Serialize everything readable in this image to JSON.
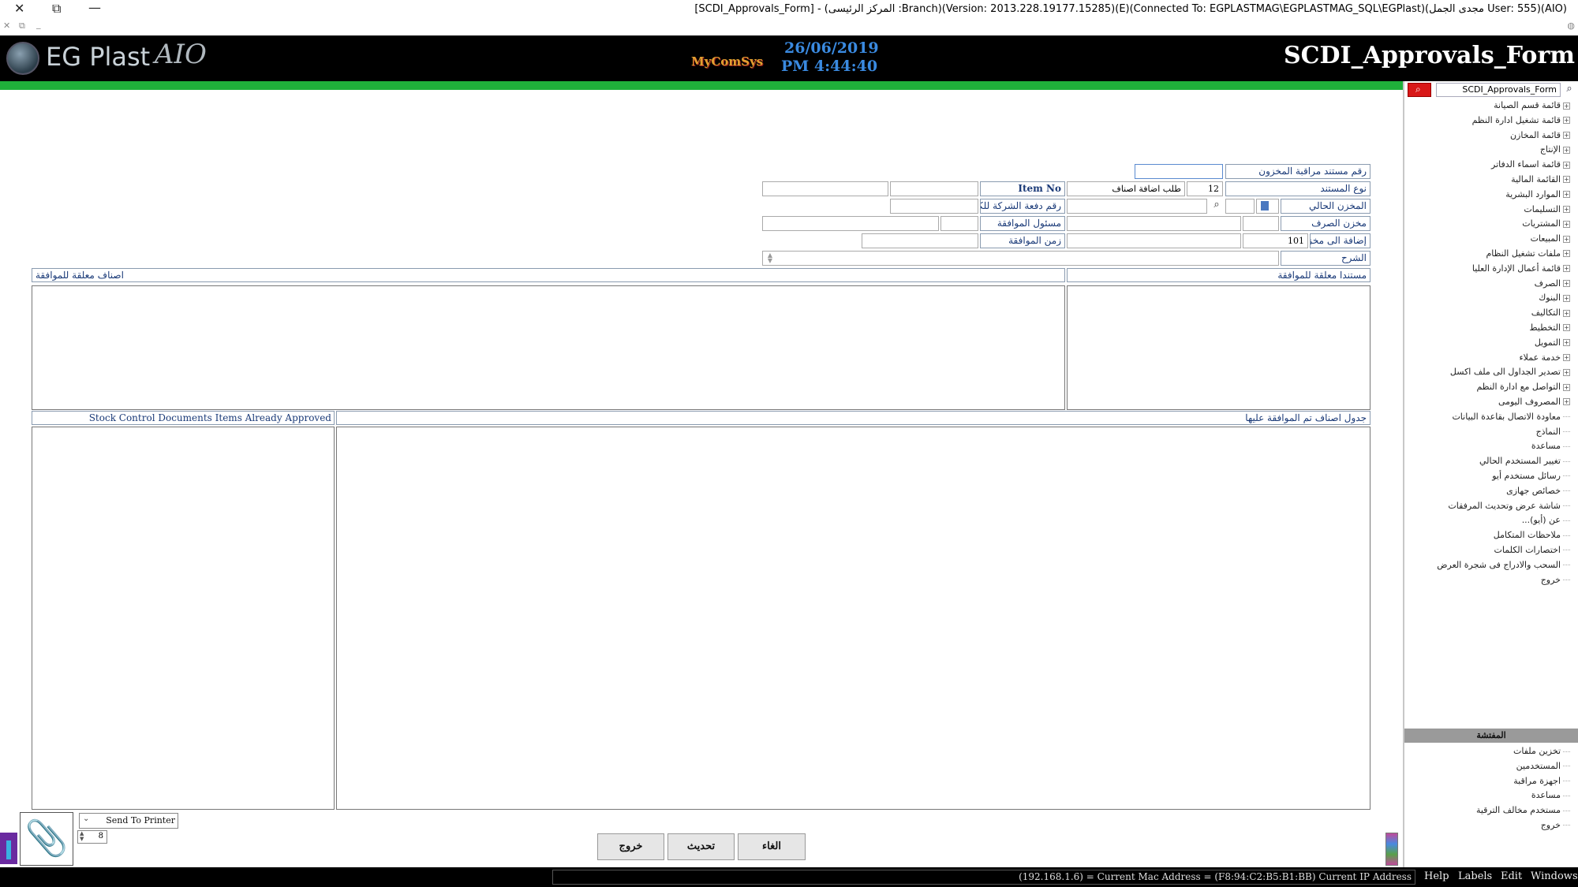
{
  "window": {
    "title": "[SCDI_Approvals_Form] - (المركز الرئيسى :Branch)(Version: 2013.228.19177.15285)(E)(Connected To: EGPLASTMAG\\EGPLASTMAG_SQL\\EGPlast)(مجدى الجمل User: 555)(AIO)",
    "close": "✕",
    "restore": "⧉",
    "minimize": "—"
  },
  "header": {
    "logo": "EG Plast",
    "logo_suffix": "AIO",
    "brand": "MyComSys",
    "date": "26/06/2019",
    "time": "PM 4:44:40",
    "form_title": "SCDI_Approvals_Form"
  },
  "form": {
    "doc_number_label": "رقم مستند مراقبة المخزون",
    "doc_type_label": "نوع المستند",
    "doc_type_code": "12",
    "doc_type_name": "طلب اضافة اصناف",
    "item_no_label": "Item No",
    "current_store_label": "المخزن الحالي",
    "company_batch_label": "رقم دفعة الشركة للكمية",
    "expense_store_label": "مخزن الصرف",
    "approver_label": "مسئول الموافقة",
    "add_to_store_label": "إضافة الى مخزن",
    "add_to_store_code": "101",
    "approval_time_label": "زمن الموافقة",
    "notes_label": "الشرح"
  },
  "panels": {
    "pending_docs": "مستندا معلقة للموافقة",
    "pending_items": "اصناف معلقة للموافقة",
    "approved_items_table": "جدول اصناف تم الموافقة عليها",
    "already_approved": "Stock Control Documents Items Already Approved"
  },
  "buttons": {
    "cancel": "الغاء",
    "refresh": "تحديث",
    "exit": "خروج"
  },
  "printer": {
    "label": "Send To Printer",
    "copies": "8"
  },
  "sidebar": {
    "search_value": "SCDI_Approvals_Form",
    "items": [
      {
        "label": "قائمة قسم الصيانة",
        "expandable": true
      },
      {
        "label": "قائمة تشغيل ادارة النظم",
        "expandable": true
      },
      {
        "label": "قائمة المخازن",
        "expandable": true
      },
      {
        "label": "الإنتاج",
        "expandable": true
      },
      {
        "label": "قائمة اسماء الدفاتر",
        "expandable": true
      },
      {
        "label": "القائمة المالية",
        "expandable": true
      },
      {
        "label": "الموارد البشرية",
        "expandable": true
      },
      {
        "label": "التسليمات",
        "expandable": true
      },
      {
        "label": "المشتريات",
        "expandable": true
      },
      {
        "label": "المبيعات",
        "expandable": true
      },
      {
        "label": "ملفات تشغيل النظام",
        "expandable": true
      },
      {
        "label": "قائمة أعمال الإدارة العليا",
        "expandable": true
      },
      {
        "label": "الصرف",
        "expandable": true
      },
      {
        "label": "البنوك",
        "expandable": true
      },
      {
        "label": "التكاليف",
        "expandable": true
      },
      {
        "label": "التخطيط",
        "expandable": true
      },
      {
        "label": "التمويل",
        "expandable": true
      },
      {
        "label": "خدمة عملاء",
        "expandable": true
      },
      {
        "label": "تصدير الجداول الى ملف اكسل",
        "expandable": true
      },
      {
        "label": "التواصل مع ادارة النظم",
        "expandable": true
      },
      {
        "label": "المصروف اليومى",
        "expandable": true
      },
      {
        "label": "معاودة الاتصال بقاعدة البيانات",
        "expandable": false
      },
      {
        "label": "النماذج",
        "expandable": false
      },
      {
        "label": "مساعدة",
        "expandable": false
      },
      {
        "label": "تغيير المستخدم الحالي",
        "expandable": false
      },
      {
        "label": "رسائل مستخدم أيو",
        "expandable": false
      },
      {
        "label": "خصائص جهازى",
        "expandable": false
      },
      {
        "label": "شاشة عرض وتحديث المرفقات",
        "expandable": false
      },
      {
        "label": "عن (أيو)...",
        "expandable": false
      },
      {
        "label": "ملاحظات المتكامل",
        "expandable": false
      },
      {
        "label": "اختصارات الكلمات",
        "expandable": false
      },
      {
        "label": "السحب والادراج فى شجرة العرض",
        "expandable": false
      },
      {
        "label": "خروج",
        "expandable": false
      }
    ],
    "admin_title": "المفتشة",
    "admin_items": [
      "تخزين ملفات",
      "المستخدمين",
      "اجهزة مراقبة",
      "مساعدة",
      "مستخدم مخالف الترقية",
      "خروج"
    ]
  },
  "statusbar": {
    "ip_text": "(192.168.1.6) = Current Mac Address = (F8:94:C2:B5:B1:BB) Current IP Address",
    "menus": [
      "Help",
      "Labels",
      "Edit",
      "Windows"
    ]
  },
  "colors": {
    "header_bg": "#000000",
    "accent_green": "#1fb03a",
    "label_text": "#1a3a78",
    "date_blue": "#3a8ae0"
  }
}
